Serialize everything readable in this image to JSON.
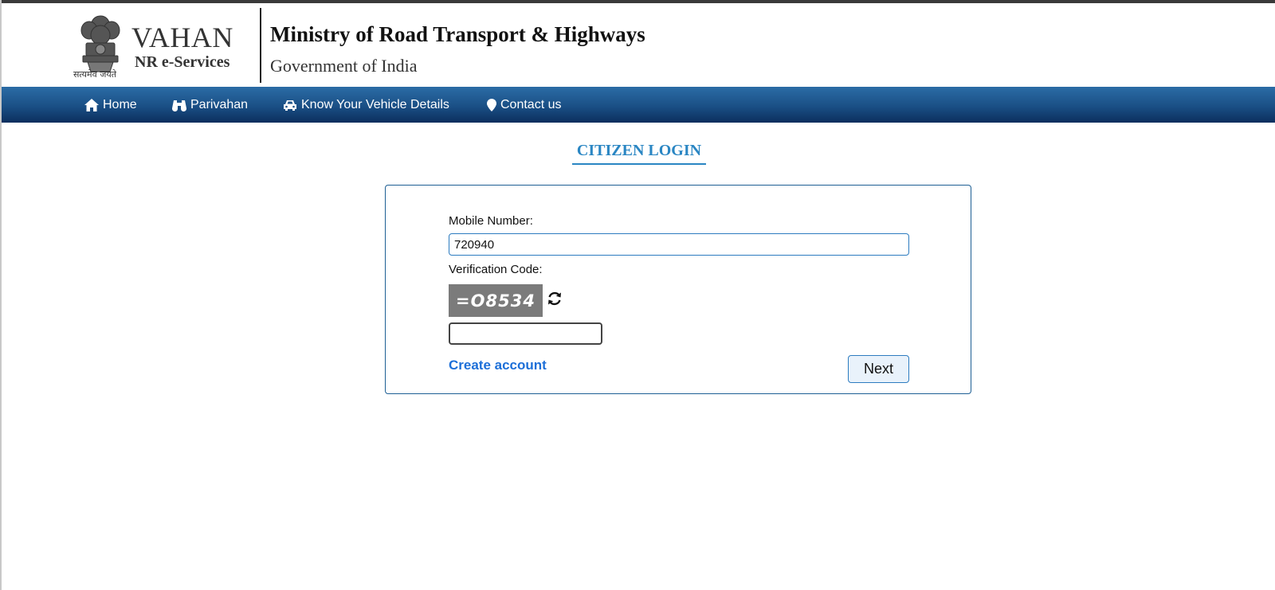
{
  "header": {
    "brand_title": "VAHAN",
    "brand_subtitle": "NR e-Services",
    "emblem_motto": "सत्यमेव जयते",
    "ministry": "Ministry of Road Transport & Highways",
    "government": "Government of India"
  },
  "nav": {
    "items": [
      {
        "label": "Home",
        "icon": "home-icon"
      },
      {
        "label": "Parivahan",
        "icon": "binoculars-icon"
      },
      {
        "label": "Know Your Vehicle Details",
        "icon": "car-icon"
      },
      {
        "label": "Contact us",
        "icon": "map-marker-icon"
      }
    ]
  },
  "login": {
    "title": "CITIZEN LOGIN",
    "mobile_label": "Mobile Number:",
    "mobile_value": "720940",
    "verification_label": "Verification Code:",
    "captcha_text": "=O8534",
    "code_value": "",
    "create_account": "Create account",
    "next_button": "Next"
  },
  "colors": {
    "nav_top": "#2b6ca6",
    "nav_bottom": "#0c2f5e",
    "title_blue": "#2a86c3",
    "link_blue": "#1d6fd8",
    "card_border": "#1e5f94"
  }
}
